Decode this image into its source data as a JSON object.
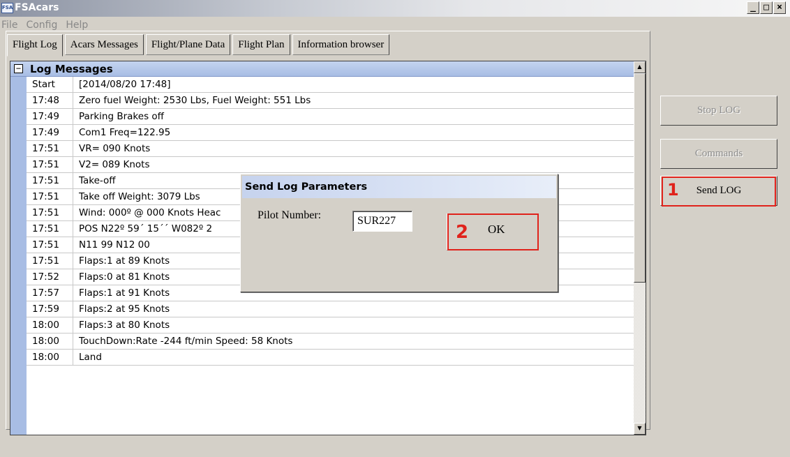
{
  "window": {
    "title": "FSAcars",
    "icon_text": "FSA",
    "controls": {
      "minimize": "_",
      "maximize": "□",
      "close": "×"
    }
  },
  "menu": [
    "File",
    "Config",
    "Help"
  ],
  "tabs": [
    {
      "label": "Flight Log",
      "active": true
    },
    {
      "label": "Acars Messages",
      "active": false
    },
    {
      "label": "Flight/Plane Data",
      "active": false
    },
    {
      "label": "Flight Plan",
      "active": false
    },
    {
      "label": "Information browser",
      "active": false
    }
  ],
  "log": {
    "collapse_symbol": "⊟",
    "header": "Log Messages",
    "rows": [
      {
        "time": "Start",
        "message": "[2014/08/20 17:48]"
      },
      {
        "time": "17:48",
        "message": "Zero fuel Weight: 2530 Lbs, Fuel Weight: 551 Lbs"
      },
      {
        "time": "17:49",
        "message": "Parking Brakes off"
      },
      {
        "time": "17:49",
        "message": "Com1 Freq=122.95"
      },
      {
        "time": "17:51",
        "message": "VR= 090 Knots"
      },
      {
        "time": "17:51",
        "message": "V2= 089 Knots"
      },
      {
        "time": "17:51",
        "message": "Take-off"
      },
      {
        "time": "17:51",
        "message": "Take off Weight: 3079 Lbs"
      },
      {
        "time": "17:51",
        "message": "Wind: 000º @ 000 Knots Heac"
      },
      {
        "time": "17:51",
        "message": "POS N22º 59´ 15´´ W082º 2"
      },
      {
        "time": "17:51",
        "message": "N11 99 N12 00"
      },
      {
        "time": "17:51",
        "message": "Flaps:1 at 89 Knots"
      },
      {
        "time": "17:52",
        "message": "Flaps:0 at 81 Knots"
      },
      {
        "time": "17:57",
        "message": "Flaps:1 at 91 Knots"
      },
      {
        "time": "17:59",
        "message": "Flaps:2 at 95 Knots"
      },
      {
        "time": "18:00",
        "message": "Flaps:3 at 80 Knots"
      },
      {
        "time": "18:00",
        "message": "TouchDown:Rate -244 ft/min Speed: 58 Knots"
      },
      {
        "time": "18:00",
        "message": "Land"
      }
    ]
  },
  "side_buttons": {
    "stop_log": "Stop LOG",
    "commands": "Commands",
    "send_log": "Send LOG"
  },
  "annotations": {
    "step1": "1",
    "step2": "2",
    "color": "#e0221b"
  },
  "dialog": {
    "title": "Send Log Parameters",
    "pilot_label": "Pilot Number:",
    "pilot_value": "SUR227",
    "ok_label": "OK"
  }
}
